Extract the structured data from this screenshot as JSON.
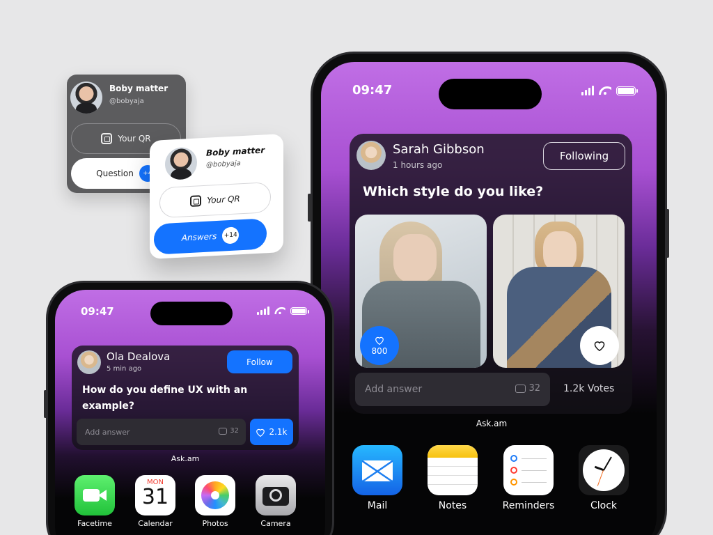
{
  "cards": {
    "dark": {
      "name": "Boby matter",
      "handle": "@bobyaja",
      "qr_label": "Your QR",
      "action_label": "Question",
      "count": "+4"
    },
    "light": {
      "name": "Boby matter",
      "handle": "@bobyaja",
      "qr_label": "Your QR",
      "action_label": "Answers",
      "count": "+14"
    }
  },
  "phone_large": {
    "time": "09:47",
    "widget": {
      "user_name": "Sarah Gibbson",
      "time_ago": "1 hours ago",
      "follow_label": "Following",
      "question": "Which style do you like?",
      "likes": "800",
      "answer_placeholder": "Add answer",
      "comments": "32",
      "votes": "1.2k Votes"
    },
    "widget_label": "Ask.am",
    "apps": [
      {
        "name": "Mail",
        "icon": "mail-icon"
      },
      {
        "name": "Notes",
        "icon": "notes-icon"
      },
      {
        "name": "Reminders",
        "icon": "reminders-icon"
      },
      {
        "name": "Clock",
        "icon": "clock-icon"
      }
    ]
  },
  "phone_small": {
    "time": "09:47",
    "widget": {
      "user_name": "Ola Dealova",
      "time_ago": "5 min ago",
      "follow_label": "Follow",
      "question": "How do you define UX with an example?",
      "answer_placeholder": "Add answer",
      "comments": "32",
      "likes": "2.1k"
    },
    "widget_label": "Ask.am",
    "apps": [
      {
        "name": "Facetime",
        "icon": "facetime-icon"
      },
      {
        "name": "Calendar",
        "icon": "calendar-icon",
        "month": "MON",
        "day": "31"
      },
      {
        "name": "Photos",
        "icon": "photos-icon"
      },
      {
        "name": "Camera",
        "icon": "camera-icon"
      }
    ]
  },
  "colors": {
    "accent_blue": "#1473ff",
    "purple": "#a850d2"
  }
}
